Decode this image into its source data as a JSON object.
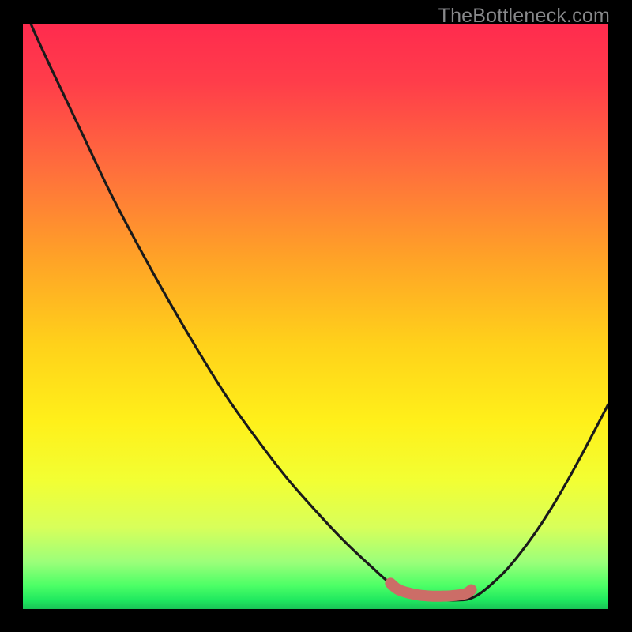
{
  "watermark": "TheBottleneck.com",
  "colors": {
    "background": "#000000",
    "curve_stroke": "#1a1a1a",
    "marker_stroke": "#cc6d67"
  },
  "chart_data": {
    "type": "line",
    "title": "",
    "xlabel": "",
    "ylabel": "",
    "xlim": [
      0,
      100
    ],
    "ylim": [
      0,
      100
    ],
    "grid": false,
    "annotations": [],
    "series": [
      {
        "name": "bottleneck-curve",
        "x": [
          0,
          1.35,
          5,
          10,
          15,
          20,
          25,
          30,
          35,
          40,
          45,
          50,
          55,
          60,
          62.5,
          65,
          66.2,
          67.6,
          70,
          72.5,
          75,
          76.3,
          78,
          80,
          82.5,
          85,
          87.5,
          90,
          92.5,
          95,
          97.5,
          100
        ],
        "y": [
          104,
          100,
          92,
          81.5,
          71,
          61.5,
          52.5,
          44,
          36,
          29,
          22.5,
          16.8,
          11.5,
          6.8,
          4.6,
          2.9,
          2.35,
          1.9,
          1.55,
          1.5,
          1.55,
          1.75,
          2.6,
          4.2,
          6.6,
          9.6,
          13,
          16.8,
          21,
          25.5,
          30.2,
          35
        ]
      }
    ],
    "marker": {
      "name": "optimal-range",
      "x": [
        62.8,
        64,
        65.5,
        67,
        68.5,
        70,
        71.5,
        73,
        74.5,
        75.8,
        76.6
      ],
      "y": [
        4.4,
        3.4,
        2.85,
        2.5,
        2.3,
        2.2,
        2.2,
        2.25,
        2.4,
        2.7,
        3.3
      ]
    }
  }
}
